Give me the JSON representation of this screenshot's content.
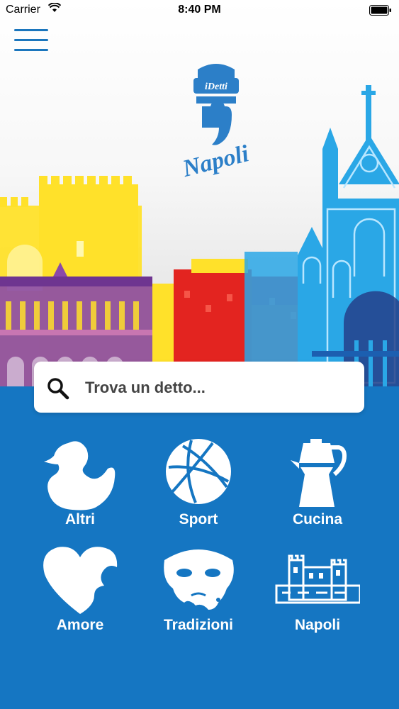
{
  "status_bar": {
    "carrier": "Carrier",
    "time": "8:40 PM"
  },
  "logo": {
    "top_text": "iDetti",
    "bottom_text": "Napoli"
  },
  "search": {
    "placeholder": "Trova un detto..."
  },
  "categories": [
    {
      "label": "Altri",
      "icon": "duck-icon"
    },
    {
      "label": "Sport",
      "icon": "basketball-icon"
    },
    {
      "label": "Cucina",
      "icon": "moka-pot-icon"
    },
    {
      "label": "Amore",
      "icon": "heart-icon"
    },
    {
      "label": "Tradizioni",
      "icon": "mask-icon"
    },
    {
      "label": "Napoli",
      "icon": "castle-icon"
    }
  ],
  "colors": {
    "primary": "#1576c2",
    "yellow": "#ffe12a",
    "red": "#e32420",
    "purple": "#8b4aa8",
    "sky": "#2aa7e6"
  }
}
